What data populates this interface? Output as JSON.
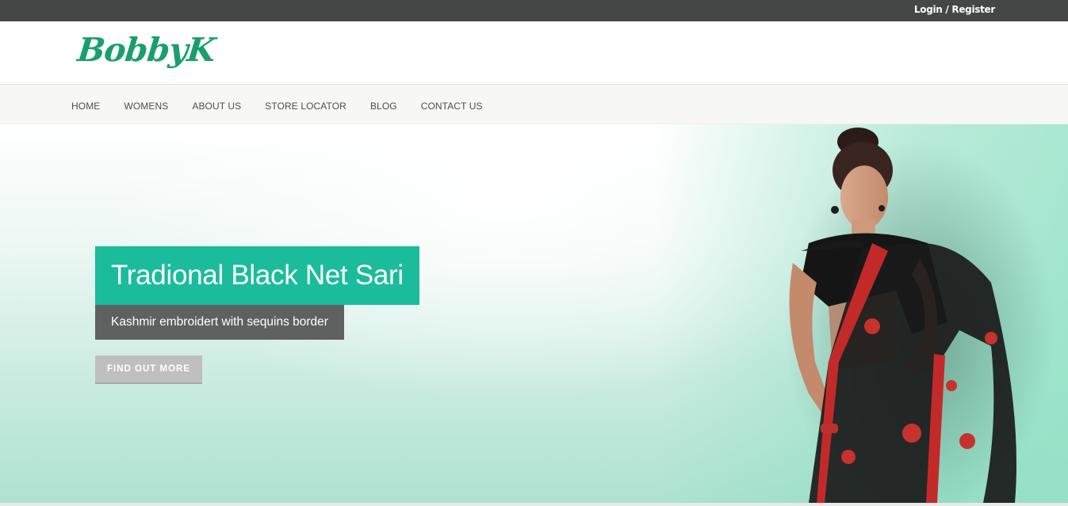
{
  "topbar": {
    "login_label": "Login / Register"
  },
  "header": {
    "logo_text": "BobbyK"
  },
  "nav": {
    "items": [
      {
        "label": "HOME"
      },
      {
        "label": "WOMENS"
      },
      {
        "label": "ABOUT US"
      },
      {
        "label": "STORE LOCATOR"
      },
      {
        "label": "BLOG"
      },
      {
        "label": "CONTACT US"
      }
    ]
  },
  "hero": {
    "title": "Tradional Black Net Sari",
    "subtitle": "Kashmir embroidert with sequins border",
    "cta_label": "FIND OUT MORE"
  },
  "colors": {
    "brand_green": "#1a9e6e",
    "title_bg": "#1abc9c",
    "subtitle_bg": "#5f6161",
    "topbar_bg": "#454747"
  }
}
